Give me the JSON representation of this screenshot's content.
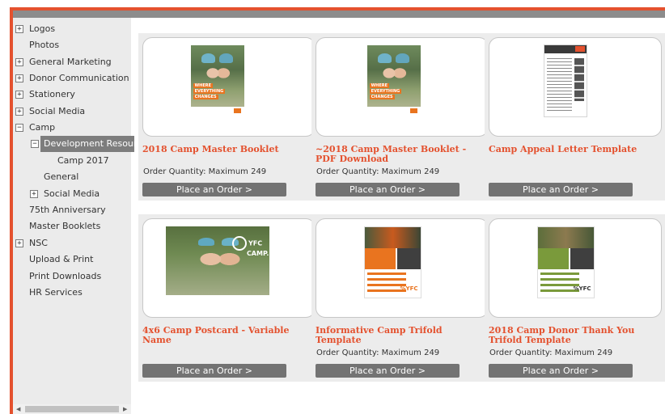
{
  "sidebar": {
    "items": [
      {
        "label": "Logos",
        "expander": "+"
      },
      {
        "label": "Photos",
        "expander": ""
      },
      {
        "label": "General Marketing",
        "expander": "+"
      },
      {
        "label": "Donor Communication",
        "expander": "+"
      },
      {
        "label": "Stationery",
        "expander": "+"
      },
      {
        "label": "Social Media",
        "expander": "+"
      },
      {
        "label": "Camp",
        "expander": "−"
      },
      {
        "label": "Development Resources",
        "expander": "−"
      },
      {
        "label": "Camp 2017",
        "expander": ""
      },
      {
        "label": "General",
        "expander": ""
      },
      {
        "label": "Social Media",
        "expander": "+"
      },
      {
        "label": "75th Anniversary",
        "expander": ""
      },
      {
        "label": "Master Booklets",
        "expander": ""
      },
      {
        "label": "NSC",
        "expander": "+"
      },
      {
        "label": "Upload & Print",
        "expander": ""
      },
      {
        "label": "Print Downloads",
        "expander": ""
      },
      {
        "label": "HR Services",
        "expander": ""
      }
    ],
    "scroll_left_icon": "triangle-left-icon",
    "scroll_right_icon": "triangle-right-icon"
  },
  "products": [
    {
      "title": "2018 Camp Master Booklet",
      "qty": "Order Quantity: Maximum 249",
      "button": "Place an Order >",
      "thumbnail": "camp-booklet-cover"
    },
    {
      "title": "~2018 Camp Master Booklet - PDF Download",
      "qty": "Order Quantity: Maximum 249",
      "button": "Place an Order >",
      "thumbnail": "camp-booklet-cover"
    },
    {
      "title": "Camp Appeal Letter Template",
      "qty": "",
      "button": "Place an Order >",
      "thumbnail": "letter-document"
    },
    {
      "title": "4x6 Camp Postcard - Variable Name",
      "qty": "",
      "button": "Place an Order >",
      "thumbnail": "postcard-photo"
    },
    {
      "title": "Informative Camp Trifold Template",
      "qty": "Order Quantity: Maximum 249",
      "button": "Place an Order >",
      "thumbnail": "trifold-orange"
    },
    {
      "title": "2018 Camp Donor Thank You Trifold Template",
      "qty": "Order Quantity: Maximum 249",
      "button": "Place an Order >",
      "thumbnail": "trifold-green"
    }
  ],
  "thumb_text": {
    "tagline": [
      "WHERE",
      "EVERYTHING",
      "CHANGES"
    ],
    "postcard_logo": [
      "YFC",
      "CAMP."
    ],
    "trifold_logo": "%YFC"
  },
  "colors": {
    "accent": "#e4512e",
    "button": "#737373",
    "sidebar_bg": "#ebebeb",
    "selected": "#7d7d7d"
  }
}
